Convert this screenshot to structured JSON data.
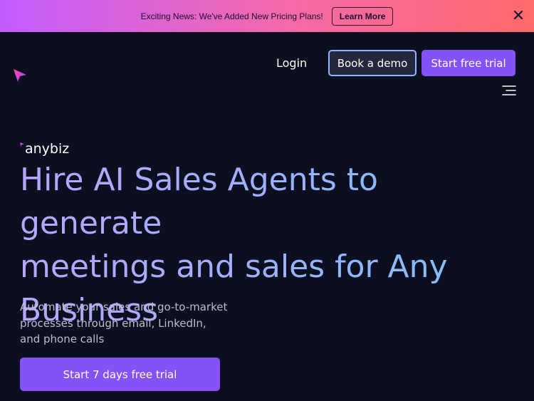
{
  "announcement": {
    "text": "Exciting News: We've Added New Pricing Plans!",
    "button_label": "Learn More",
    "close_icon": "close-icon"
  },
  "nav": {
    "logo_icon": "cursor-arrow-icon",
    "login_label": "Login",
    "demo_label": "Book a demo",
    "trial_label": "Start free trial",
    "menu_icon": "hamburger-menu-icon"
  },
  "hero": {
    "brand_name": "anybiz",
    "headline_line1": "Hire AI Sales Agents to generate",
    "headline_line2": "meetings and sales for Any",
    "headline_line3": "Business",
    "subtext_line1": "Automate your sales and go-to-market",
    "subtext_line2": "processes through email, LinkedIn,",
    "subtext_line3": "and phone calls",
    "cta_label": "Start 7 days free trial"
  },
  "colors": {
    "background": "#0b0f1f",
    "accent": "#8452f6",
    "banner_gradient_start": "#c25cff",
    "banner_gradient_end": "#ff6a6a"
  }
}
